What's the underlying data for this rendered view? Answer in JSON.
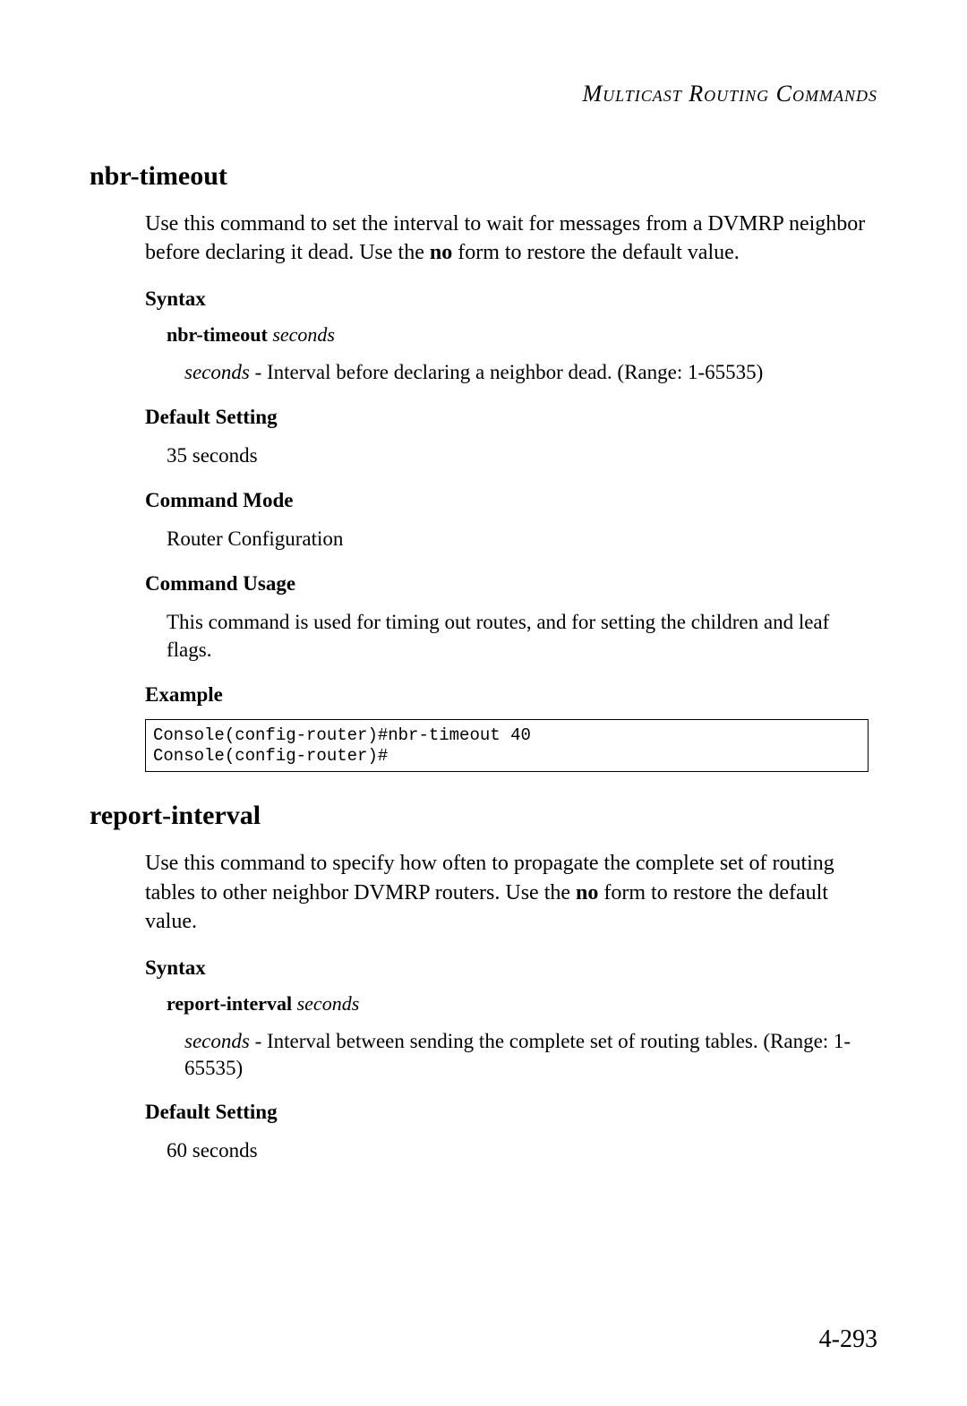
{
  "header": {
    "section_title": "Multicast Routing Commands"
  },
  "commands": [
    {
      "name": "nbr-timeout",
      "intro_before_no": "Use this command to set the interval to wait for messages from a DVMRP neighbor before declaring it dead. Use the ",
      "intro_no": "no",
      "intro_after_no": " form to restore the default value.",
      "syntax_label": "Syntax",
      "syntax_cmd": "nbr-timeout",
      "syntax_arg": "seconds",
      "param_name": "seconds",
      "param_desc": " - Interval before declaring a neighbor dead. (Range: 1-65535)",
      "default_label": "Default Setting",
      "default_value": "35 seconds",
      "mode_label": "Command Mode",
      "mode_value": "Router Configuration",
      "usage_label": "Command Usage",
      "usage_text": "This command is used for timing out routes, and for setting the children and leaf flags.",
      "example_label": "Example",
      "example_text": "Console(config-router)#nbr-timeout 40\nConsole(config-router)#"
    },
    {
      "name": "report-interval",
      "intro_before_no": "Use this command to specify how often to propagate the complete set of routing tables to other neighbor DVMRP routers. Use the ",
      "intro_no": "no",
      "intro_after_no": " form to restore the default value.",
      "syntax_label": "Syntax",
      "syntax_cmd": "report-interval",
      "syntax_arg": "seconds",
      "param_name": "seconds",
      "param_desc": " - Interval between sending the complete set of routing tables. (Range: 1-65535)",
      "default_label": "Default Setting",
      "default_value": "60 seconds"
    }
  ],
  "page_number": "4-293"
}
